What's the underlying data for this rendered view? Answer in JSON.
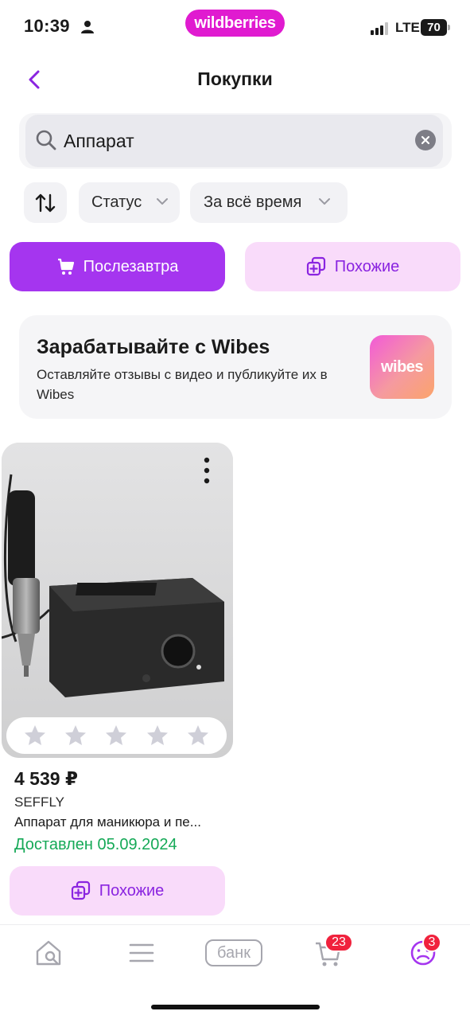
{
  "status_bar": {
    "time": "10:39",
    "brand": "wildberries",
    "network": "LTE",
    "battery": "70"
  },
  "header": {
    "title": "Покупки",
    "back_icon": "chevron-left-icon"
  },
  "search": {
    "value": "Аппарат",
    "icon": "search-icon",
    "clear_icon": "clear-icon"
  },
  "filters": {
    "sort_icon": "sort-icon",
    "status_label": "Статус",
    "period_label": "За всё время"
  },
  "actions": {
    "primary_label": "Послезавтра",
    "primary_icon": "cart-icon",
    "similar_label": "Похожие",
    "similar_icon": "similar-icon"
  },
  "banner": {
    "title": "Зарабатывайте с Wibes",
    "text": "Оставляйте отзывы с видео и публикуйте их в Wibes",
    "logo_text": "wibes"
  },
  "product": {
    "price": "4 539 ₽",
    "brand": "SEFFLY",
    "name": "Аппарат для маникюра и пе...",
    "delivery": "Доставлен 05.09.2024",
    "rating_stars": 0,
    "rating_max": 5,
    "similar_label": "Похожие"
  },
  "tabbar": {
    "items": [
      {
        "name": "home",
        "icon": "home-search-icon"
      },
      {
        "name": "catalog",
        "icon": "menu-icon"
      },
      {
        "name": "bank",
        "label": "банк"
      },
      {
        "name": "cart",
        "icon": "cart-icon",
        "badge": "23"
      },
      {
        "name": "profile",
        "icon": "profile-icon",
        "badge": "3"
      }
    ]
  },
  "colors": {
    "brand": "#e01bd0",
    "primary": "#a535ef",
    "secondary_bg": "#f9dbfa",
    "secondary_text": "#8a24e0",
    "delivered": "#15a957",
    "badge": "#f0223d"
  }
}
